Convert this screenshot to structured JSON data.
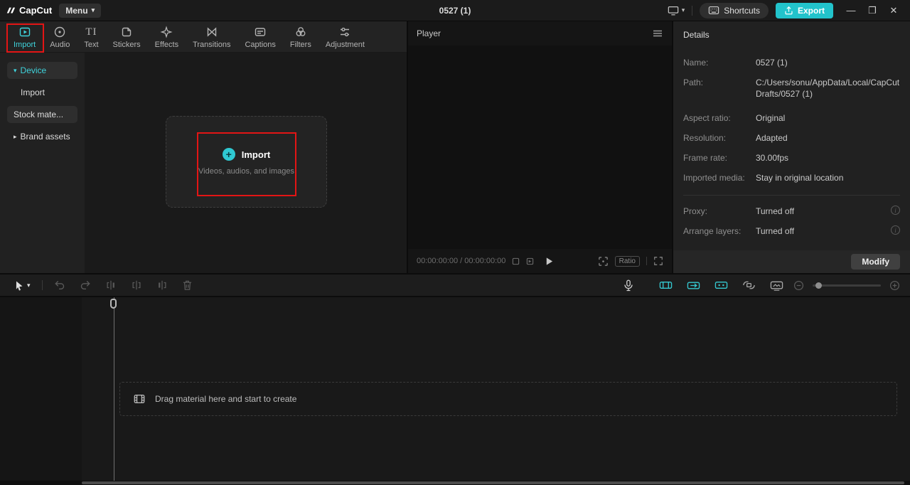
{
  "titlebar": {
    "logo": "CapCut",
    "menu_label": "Menu",
    "document_title": "0527 (1)",
    "shortcuts_label": "Shortcuts",
    "export_label": "Export",
    "minimize_glyph": "—",
    "maximize_glyph": "❐",
    "close_glyph": "✕"
  },
  "icons": {
    "chevron_down": "▾",
    "chevron_right": "▸",
    "text_tab_glyph": "TI",
    "plus_glyph": "+",
    "info_glyph": "i",
    "minus_glyph": "−",
    "plus_small_glyph": "+"
  },
  "media_tabs": [
    {
      "label": "Import",
      "active": true
    },
    {
      "label": "Audio",
      "active": false
    },
    {
      "label": "Text",
      "active": false
    },
    {
      "label": "Stickers",
      "active": false
    },
    {
      "label": "Effects",
      "active": false
    },
    {
      "label": "Transitions",
      "active": false
    },
    {
      "label": "Captions",
      "active": false
    },
    {
      "label": "Filters",
      "active": false
    },
    {
      "label": "Adjustment",
      "active": false
    }
  ],
  "sidebar": {
    "items": [
      {
        "label": "Device",
        "selected": true
      },
      {
        "label": "Import",
        "selected": false
      },
      {
        "label": "Stock mate...",
        "selected": false
      },
      {
        "label": "Brand assets",
        "selected": false
      }
    ]
  },
  "import_zone": {
    "button_label": "Import",
    "hint": "Videos, audios, and images"
  },
  "player": {
    "title": "Player",
    "timecode": "00:00:00:00 / 00:00:00:00",
    "ratio_label": "Ratio"
  },
  "details": {
    "title": "Details",
    "rows": [
      {
        "label": "Name:",
        "value": "0527 (1)"
      },
      {
        "label": "Path:",
        "value": "C:/Users/sonu/AppData/Local/CapCut Drafts/0527 (1)"
      },
      {
        "label": "Aspect ratio:",
        "value": "Original"
      },
      {
        "label": "Resolution:",
        "value": "Adapted"
      },
      {
        "label": "Frame rate:",
        "value": "30.00fps"
      },
      {
        "label": "Imported media:",
        "value": "Stay in original location"
      },
      {
        "label": "Proxy:",
        "value": "Turned off"
      },
      {
        "label": "Arrange layers:",
        "value": "Turned off"
      }
    ],
    "modify_label": "Modify"
  },
  "timeline": {
    "drop_hint": "Drag material here and start to create"
  },
  "colors": {
    "accent": "#3fd3dc",
    "export_button": "#22c3cb",
    "annotation": "#e31515",
    "panel_bg": "#212121"
  }
}
